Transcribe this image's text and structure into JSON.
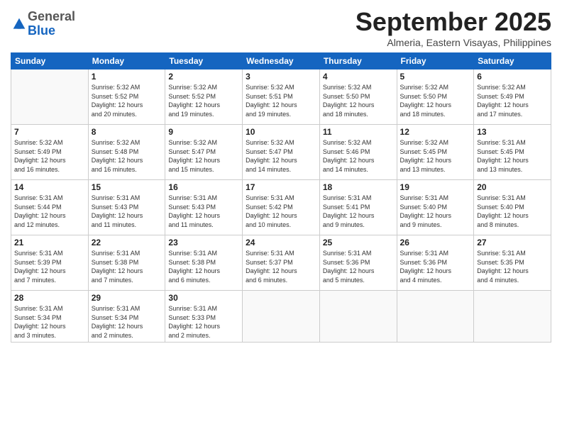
{
  "logo": {
    "general": "General",
    "blue": "Blue"
  },
  "header": {
    "month": "September 2025",
    "location": "Almeria, Eastern Visayas, Philippines"
  },
  "days_of_week": [
    "Sunday",
    "Monday",
    "Tuesday",
    "Wednesday",
    "Thursday",
    "Friday",
    "Saturday"
  ],
  "weeks": [
    [
      {
        "day": "",
        "info": ""
      },
      {
        "day": "1",
        "info": "Sunrise: 5:32 AM\nSunset: 5:52 PM\nDaylight: 12 hours\nand 20 minutes."
      },
      {
        "day": "2",
        "info": "Sunrise: 5:32 AM\nSunset: 5:52 PM\nDaylight: 12 hours\nand 19 minutes."
      },
      {
        "day": "3",
        "info": "Sunrise: 5:32 AM\nSunset: 5:51 PM\nDaylight: 12 hours\nand 19 minutes."
      },
      {
        "day": "4",
        "info": "Sunrise: 5:32 AM\nSunset: 5:50 PM\nDaylight: 12 hours\nand 18 minutes."
      },
      {
        "day": "5",
        "info": "Sunrise: 5:32 AM\nSunset: 5:50 PM\nDaylight: 12 hours\nand 18 minutes."
      },
      {
        "day": "6",
        "info": "Sunrise: 5:32 AM\nSunset: 5:49 PM\nDaylight: 12 hours\nand 17 minutes."
      }
    ],
    [
      {
        "day": "7",
        "info": "Sunrise: 5:32 AM\nSunset: 5:49 PM\nDaylight: 12 hours\nand 16 minutes."
      },
      {
        "day": "8",
        "info": "Sunrise: 5:32 AM\nSunset: 5:48 PM\nDaylight: 12 hours\nand 16 minutes."
      },
      {
        "day": "9",
        "info": "Sunrise: 5:32 AM\nSunset: 5:47 PM\nDaylight: 12 hours\nand 15 minutes."
      },
      {
        "day": "10",
        "info": "Sunrise: 5:32 AM\nSunset: 5:47 PM\nDaylight: 12 hours\nand 14 minutes."
      },
      {
        "day": "11",
        "info": "Sunrise: 5:32 AM\nSunset: 5:46 PM\nDaylight: 12 hours\nand 14 minutes."
      },
      {
        "day": "12",
        "info": "Sunrise: 5:32 AM\nSunset: 5:45 PM\nDaylight: 12 hours\nand 13 minutes."
      },
      {
        "day": "13",
        "info": "Sunrise: 5:31 AM\nSunset: 5:45 PM\nDaylight: 12 hours\nand 13 minutes."
      }
    ],
    [
      {
        "day": "14",
        "info": "Sunrise: 5:31 AM\nSunset: 5:44 PM\nDaylight: 12 hours\nand 12 minutes."
      },
      {
        "day": "15",
        "info": "Sunrise: 5:31 AM\nSunset: 5:43 PM\nDaylight: 12 hours\nand 11 minutes."
      },
      {
        "day": "16",
        "info": "Sunrise: 5:31 AM\nSunset: 5:43 PM\nDaylight: 12 hours\nand 11 minutes."
      },
      {
        "day": "17",
        "info": "Sunrise: 5:31 AM\nSunset: 5:42 PM\nDaylight: 12 hours\nand 10 minutes."
      },
      {
        "day": "18",
        "info": "Sunrise: 5:31 AM\nSunset: 5:41 PM\nDaylight: 12 hours\nand 9 minutes."
      },
      {
        "day": "19",
        "info": "Sunrise: 5:31 AM\nSunset: 5:40 PM\nDaylight: 12 hours\nand 9 minutes."
      },
      {
        "day": "20",
        "info": "Sunrise: 5:31 AM\nSunset: 5:40 PM\nDaylight: 12 hours\nand 8 minutes."
      }
    ],
    [
      {
        "day": "21",
        "info": "Sunrise: 5:31 AM\nSunset: 5:39 PM\nDaylight: 12 hours\nand 7 minutes."
      },
      {
        "day": "22",
        "info": "Sunrise: 5:31 AM\nSunset: 5:38 PM\nDaylight: 12 hours\nand 7 minutes."
      },
      {
        "day": "23",
        "info": "Sunrise: 5:31 AM\nSunset: 5:38 PM\nDaylight: 12 hours\nand 6 minutes."
      },
      {
        "day": "24",
        "info": "Sunrise: 5:31 AM\nSunset: 5:37 PM\nDaylight: 12 hours\nand 6 minutes."
      },
      {
        "day": "25",
        "info": "Sunrise: 5:31 AM\nSunset: 5:36 PM\nDaylight: 12 hours\nand 5 minutes."
      },
      {
        "day": "26",
        "info": "Sunrise: 5:31 AM\nSunset: 5:36 PM\nDaylight: 12 hours\nand 4 minutes."
      },
      {
        "day": "27",
        "info": "Sunrise: 5:31 AM\nSunset: 5:35 PM\nDaylight: 12 hours\nand 4 minutes."
      }
    ],
    [
      {
        "day": "28",
        "info": "Sunrise: 5:31 AM\nSunset: 5:34 PM\nDaylight: 12 hours\nand 3 minutes."
      },
      {
        "day": "29",
        "info": "Sunrise: 5:31 AM\nSunset: 5:34 PM\nDaylight: 12 hours\nand 2 minutes."
      },
      {
        "day": "30",
        "info": "Sunrise: 5:31 AM\nSunset: 5:33 PM\nDaylight: 12 hours\nand 2 minutes."
      },
      {
        "day": "",
        "info": ""
      },
      {
        "day": "",
        "info": ""
      },
      {
        "day": "",
        "info": ""
      },
      {
        "day": "",
        "info": ""
      }
    ]
  ]
}
